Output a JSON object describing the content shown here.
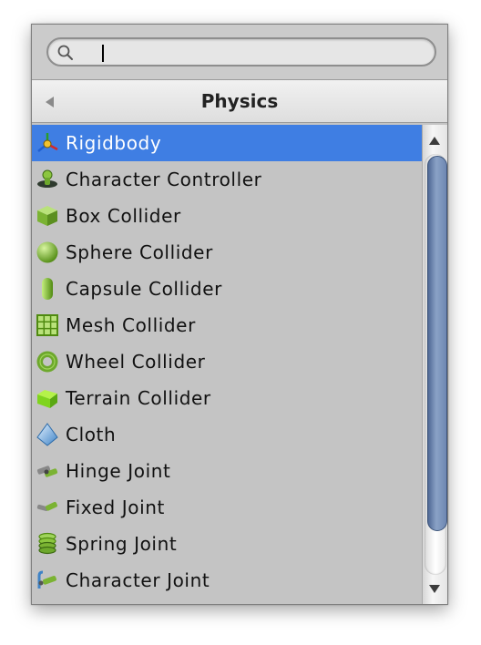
{
  "search": {
    "value": "",
    "placeholder": ""
  },
  "header": {
    "title": "Physics"
  },
  "items": [
    {
      "label": "Rigidbody",
      "icon": "rigidbody-icon",
      "selected": true
    },
    {
      "label": "Character Controller",
      "icon": "character-controller-icon",
      "selected": false
    },
    {
      "label": "Box Collider",
      "icon": "box-collider-icon",
      "selected": false
    },
    {
      "label": "Sphere Collider",
      "icon": "sphere-collider-icon",
      "selected": false
    },
    {
      "label": "Capsule Collider",
      "icon": "capsule-collider-icon",
      "selected": false
    },
    {
      "label": "Mesh Collider",
      "icon": "mesh-collider-icon",
      "selected": false
    },
    {
      "label": "Wheel Collider",
      "icon": "wheel-collider-icon",
      "selected": false
    },
    {
      "label": "Terrain Collider",
      "icon": "terrain-collider-icon",
      "selected": false
    },
    {
      "label": "Cloth",
      "icon": "cloth-icon",
      "selected": false
    },
    {
      "label": "Hinge Joint",
      "icon": "hinge-joint-icon",
      "selected": false
    },
    {
      "label": "Fixed Joint",
      "icon": "fixed-joint-icon",
      "selected": false
    },
    {
      "label": "Spring Joint",
      "icon": "spring-joint-icon",
      "selected": false
    },
    {
      "label": "Character Joint",
      "icon": "character-joint-icon",
      "selected": false
    }
  ],
  "scrollbar": {
    "visible_fraction": 0.9,
    "scroll_position": 0.0
  },
  "colors": {
    "selection": "#3f7ee3",
    "selected_text": "#ffffff",
    "panel": "#c4c4c4",
    "icon_green": "#8cc63f",
    "icon_dark_green": "#4f8a10",
    "scroll_thumb": "#6e87b2"
  }
}
